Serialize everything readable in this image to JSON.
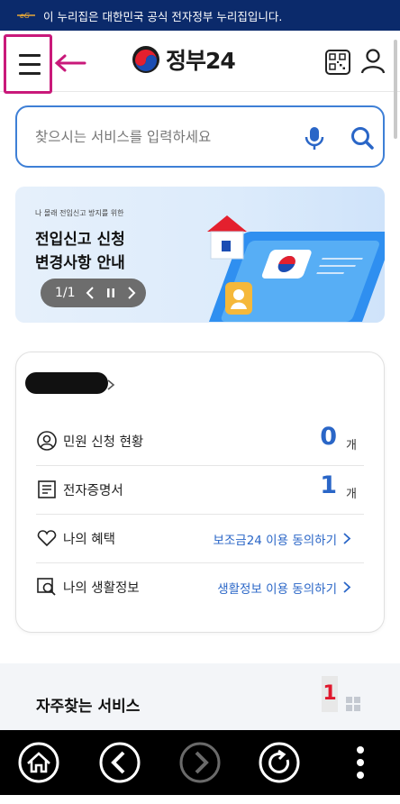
{
  "gov_banner": {
    "text": "이 누리집은 대한민국 공식 전자정부 누리집입니다."
  },
  "header": {
    "logo_text": "정부24",
    "icons": [
      "menu-icon",
      "qr-code-icon",
      "user-icon"
    ]
  },
  "search": {
    "placeholder": "찾으시는 서비스를 입력하세요",
    "value": ""
  },
  "promo": {
    "small_text": "나 몰래 전입신고 방지를 위한",
    "title_line1": "전입신고 신청",
    "title_line2": "변경사항 안내",
    "pager_count": "1/1"
  },
  "card": {
    "rows": [
      {
        "label": "민원 신청 현황",
        "value": "0",
        "unit": "개",
        "icon": "person-circle-icon"
      },
      {
        "label": "전자증명서",
        "value": "1",
        "unit": "개",
        "icon": "document-icon"
      },
      {
        "label": "나의 혜택",
        "link": "보조금24 이용 동의하기",
        "icon": "heart-icon"
      },
      {
        "label": "나의 생활정보",
        "link": "생활정보 이용 동의하기",
        "icon": "search-doc-icon"
      }
    ]
  },
  "frequent": {
    "title": "자주찾는 서비스",
    "annotation": "1"
  },
  "colors": {
    "brand_navy": "#0b2a6b",
    "accent_blue": "#2a66c7",
    "annotation_magenta": "#c9197a",
    "annotation_red": "#e0182d"
  }
}
